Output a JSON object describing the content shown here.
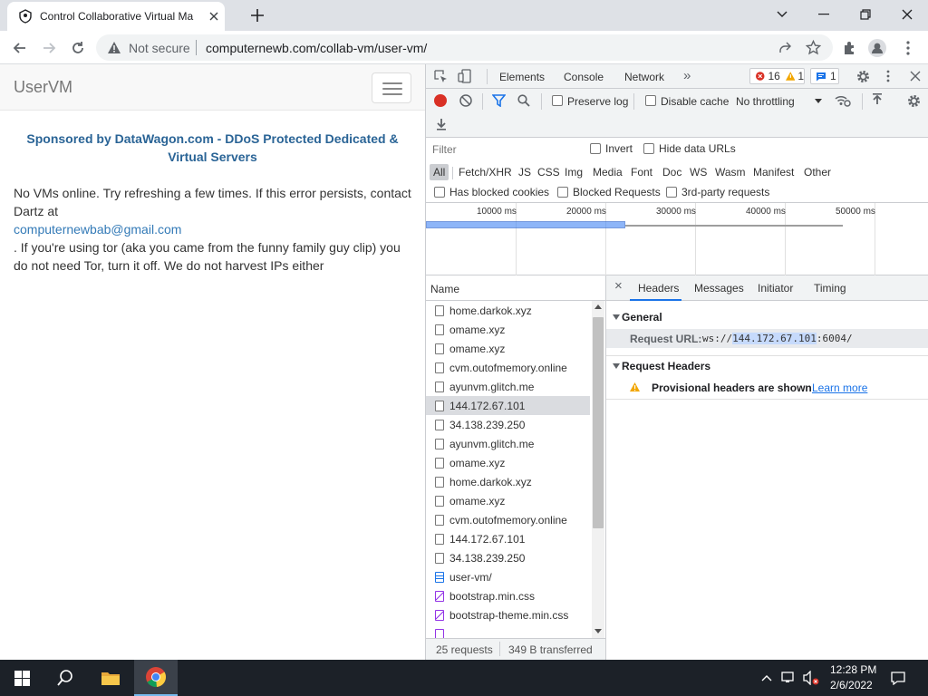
{
  "browser": {
    "tab_title": "Control Collaborative Virtual Ma",
    "url": "computernewb.com/collab-vm/user-vm/",
    "security_label": "Not secure"
  },
  "page": {
    "brand": "UserVM",
    "sponsor": "Sponsored by DataWagon.com - DDoS Protected Dedicated & Virtual Servers",
    "message_1": "No VMs online. Try refreshing a few times. If this error persists, contact Dartz at",
    "email": "computernewbab@gmail.com",
    "message_2": ". If you're using tor (aka you came from the funny family guy clip) you do not need Tor, turn it off. We do not harvest IPs either"
  },
  "devtools": {
    "tabs": [
      "Elements",
      "Console",
      "Network"
    ],
    "more": "»",
    "errors": "16",
    "warnings": "1",
    "messages": "1",
    "toolbar": {
      "preserve_log": "Preserve log",
      "disable_cache": "Disable cache",
      "throttling": "No throttling"
    },
    "filter": {
      "placeholder": "Filter",
      "invert": "Invert",
      "hide_data_urls": "Hide data URLs",
      "types": [
        "All",
        "Fetch/XHR",
        "JS",
        "CSS",
        "Img",
        "Media",
        "Font",
        "Doc",
        "WS",
        "Wasm",
        "Manifest",
        "Other"
      ],
      "has_blocked_cookies": "Has blocked cookies",
      "blocked_requests": "Blocked Requests",
      "third_party": "3rd-party requests"
    },
    "timeline": {
      "ticks": [
        "10000 ms",
        "20000 ms",
        "30000 ms",
        "40000 ms",
        "50000 ms"
      ]
    },
    "list": {
      "header": "Name",
      "rows": [
        "home.darkok.xyz",
        "omame.xyz",
        "omame.xyz",
        "cvm.outofmemory.online",
        "ayunvm.glitch.me",
        "144.172.67.101",
        "34.138.239.250",
        "ayunvm.glitch.me",
        "omame.xyz",
        "home.darkok.xyz",
        "omame.xyz",
        "cvm.outofmemory.online",
        "144.172.67.101",
        "34.138.239.250",
        "user-vm/",
        "bootstrap.min.css",
        "bootstrap-theme.min.css"
      ],
      "status_requests": "25 requests",
      "status_transferred": "349 B transferred"
    },
    "details": {
      "close": "×",
      "tabs": [
        "Headers",
        "Messages",
        "Initiator",
        "Timing"
      ],
      "general": "General",
      "request_url_label": "Request URL:",
      "request_url_prefix": "ws://",
      "request_url_host": "144.172.67.101",
      "request_url_suffix": ":6004/",
      "request_headers": "Request Headers",
      "provisional": "Provisional headers are shown",
      "learn_more": "Learn more"
    }
  },
  "taskbar": {
    "time": "12:28 PM",
    "date": "2/6/2022"
  }
}
